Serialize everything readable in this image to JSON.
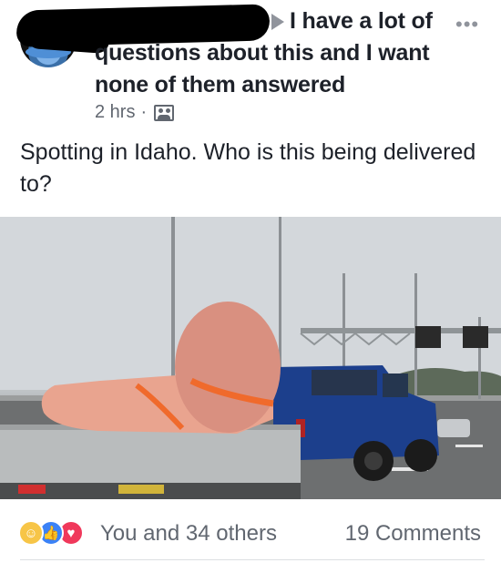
{
  "post": {
    "group_title": "I have a lot of questions about this and I want none of them answered",
    "timestamp": "2 hrs",
    "separator": "·",
    "audience_icon": "friends-icon",
    "more_icon": "ellipsis-icon",
    "body": "Spotting in Idaho. Who is this being delivered to?"
  },
  "reactions": {
    "icons": [
      "haha-icon",
      "like-icon",
      "love-icon"
    ],
    "count_text": "You and 34 others",
    "comments_text": "19 Comments"
  },
  "colors": {
    "text": "#1d2129",
    "meta": "#616770",
    "like": "#3b82f6",
    "love": "#f0385b",
    "haha": "#f7c547"
  }
}
